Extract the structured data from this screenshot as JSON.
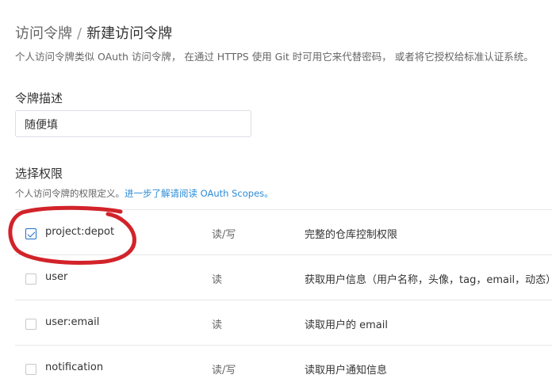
{
  "breadcrumb": {
    "parent": "访问令牌",
    "separator": "/",
    "current": "新建访问令牌"
  },
  "description": "个人访问令牌类似 OAuth 访问令牌， 在通过 HTTPS 使用 Git 时可用它来代替密码， 或者将它授权给标准认证系统。",
  "token_description": {
    "label": "令牌描述",
    "value": "随便填"
  },
  "scopes": {
    "label": "选择权限",
    "hint": "个人访问令牌的权限定义。",
    "hint_link": "进一步了解请阅读 OAuth Scopes。",
    "rows": [
      {
        "name": "project:depot",
        "permission": "读/写",
        "description": "完整的仓库控制权限",
        "checked": true
      },
      {
        "name": "user",
        "permission": "读",
        "description": "获取用户信息（用户名称，头像，tag，email，动态）",
        "checked": false
      },
      {
        "name": "user:email",
        "permission": "读",
        "description": "读取用户的 email",
        "checked": false
      },
      {
        "name": "notification",
        "permission": "读/写",
        "description": "读取用户通知信息",
        "checked": false
      }
    ]
  },
  "annotation_color": "#d2232a"
}
